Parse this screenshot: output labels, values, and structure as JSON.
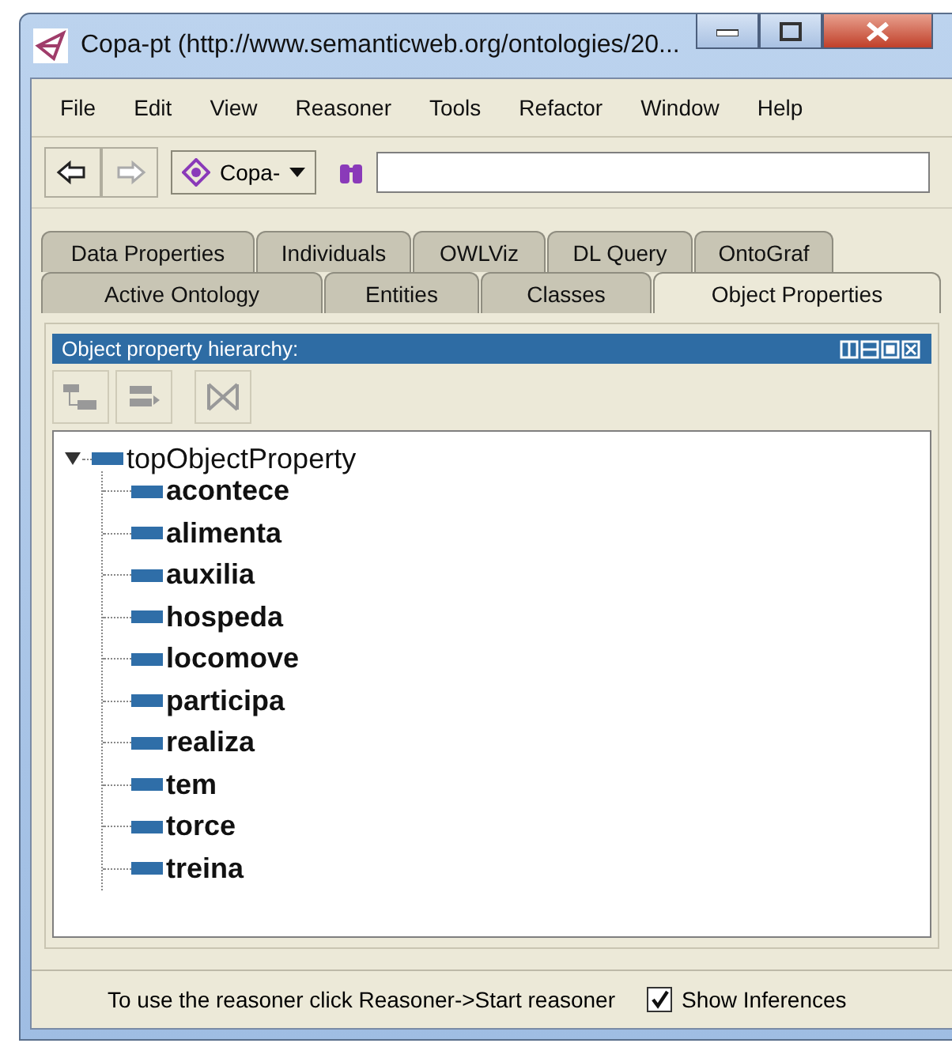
{
  "window": {
    "title": "Copa-pt (http://www.semanticweb.org/ontologies/20..."
  },
  "menu": [
    "File",
    "Edit",
    "View",
    "Reasoner",
    "Tools",
    "Refactor",
    "Window",
    "Help"
  ],
  "toolbar": {
    "back_disabled": false,
    "forward_disabled": true,
    "ontology": "Copa-"
  },
  "tab_rows": [
    [
      {
        "label": "Data Properties",
        "selected": false
      },
      {
        "label": "Individuals",
        "selected": false
      },
      {
        "label": "OWLViz",
        "selected": false
      },
      {
        "label": "DL Query",
        "selected": false
      },
      {
        "label": "OntoGraf",
        "selected": false
      }
    ],
    [
      {
        "label": "Active Ontology",
        "selected": false
      },
      {
        "label": "Entities",
        "selected": false
      },
      {
        "label": "Classes",
        "selected": false
      },
      {
        "label": "Object Properties",
        "selected": true
      }
    ]
  ],
  "panel": {
    "title": "Object property hierarchy:",
    "tree": [
      {
        "label": "topObjectProperty",
        "expanded": true,
        "children": [
          {
            "label": "acontece"
          },
          {
            "label": "alimenta"
          },
          {
            "label": "auxilia"
          },
          {
            "label": "hospeda"
          },
          {
            "label": "locomove"
          },
          {
            "label": "participa"
          },
          {
            "label": "realiza"
          },
          {
            "label": "tem"
          },
          {
            "label": "torce"
          },
          {
            "label": "treina"
          }
        ]
      }
    ]
  },
  "status_bar": {
    "message": "To use the reasoner click Reasoner->Start reasoner",
    "show_inferences": {
      "label": "Show Inferences",
      "checked": true
    }
  }
}
